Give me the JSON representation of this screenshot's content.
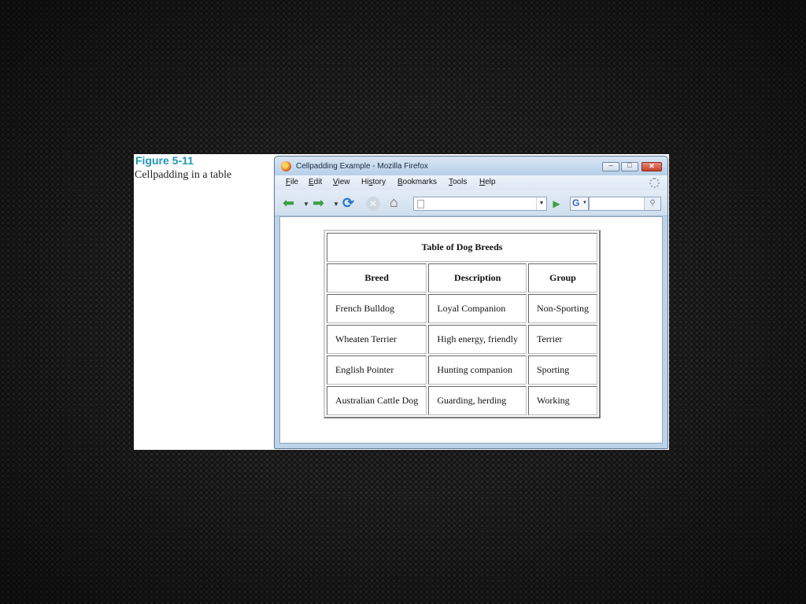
{
  "figure": {
    "label": "Figure 5-11",
    "caption": "Cellpadding in a table"
  },
  "window": {
    "title": "Cellpadding Example - Mozilla Firefox",
    "controls": {
      "minimize": "–",
      "maximize": "□",
      "close": "✕"
    }
  },
  "menu": {
    "items": [
      {
        "key": "F",
        "rest": "ile"
      },
      {
        "key": "E",
        "rest": "dit"
      },
      {
        "key": "V",
        "rest": "iew"
      },
      {
        "key": "",
        "pre": "Hi",
        "mid": "s",
        "post": "tory"
      },
      {
        "key": "B",
        "rest": "ookmarks"
      },
      {
        "key": "T",
        "rest": "ools"
      },
      {
        "key": "H",
        "rest": "elp"
      }
    ]
  },
  "toolbar": {
    "back_icon": "back-arrow-icon",
    "forward_icon": "forward-arrow-icon",
    "reload_icon": "reload-icon",
    "stop_icon": "stop-icon",
    "home_icon": "home-icon",
    "url_value": "",
    "search_value": "",
    "search_engine": "G"
  },
  "table": {
    "caption": "Table of Dog Breeds",
    "headers": [
      "Breed",
      "Description",
      "Group"
    ],
    "rows": [
      [
        "French Bulldog",
        "Loyal Companion",
        "Non-Sporting"
      ],
      [
        "Wheaten Terrier",
        "High energy, friendly",
        "Terrier"
      ],
      [
        "English Pointer",
        "Hunting companion",
        "Sporting"
      ],
      [
        "Australian Cattle Dog",
        "Guarding, herding",
        "Working"
      ]
    ]
  },
  "colors": {
    "figure_label": "#1e97b3",
    "window_frame": "#bcd3ea"
  }
}
